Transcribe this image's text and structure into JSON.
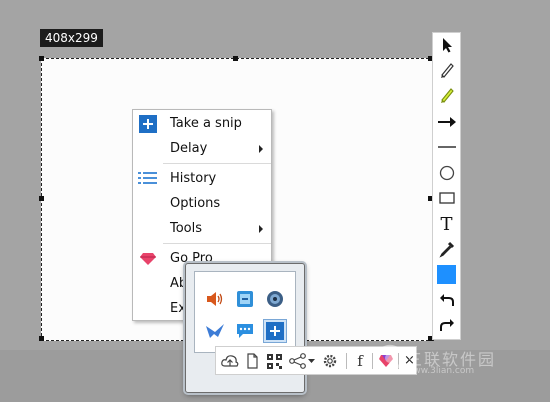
{
  "selection": {
    "size_label": "408x299"
  },
  "context_menu": {
    "items": [
      {
        "label": "Take a snip",
        "icon": "plus-icon"
      },
      {
        "label": "Delay",
        "icon": "",
        "submenu": true
      },
      {
        "label": "History",
        "icon": "list-icon"
      },
      {
        "label": "Options",
        "icon": ""
      },
      {
        "label": "Tools",
        "icon": "",
        "submenu": true
      },
      {
        "label": "Go Pro",
        "icon": "gem-icon"
      },
      {
        "label": "Ab",
        "icon": ""
      },
      {
        "label": "Ex",
        "icon": ""
      }
    ]
  },
  "right_toolbar": {
    "tools": [
      "pointer-icon",
      "pen-icon",
      "highlighter-icon",
      "arrow-icon",
      "line-icon",
      "circle-icon",
      "rectangle-icon",
      "text-icon",
      "eyedropper-icon",
      "color-swatch",
      "undo-icon",
      "redo-icon"
    ],
    "color": "#1e90ff",
    "text_tool_label": "T"
  },
  "popup": {
    "icons": [
      "speaker-icon",
      "qq-icon",
      "disc-icon",
      "bird-icon",
      "chat-icon",
      "plus-icon"
    ]
  },
  "bottom_toolbar": {
    "items": [
      "cloud-upload-icon",
      "copy-icon",
      "qr-code-icon",
      "share-icon",
      "gear-icon",
      "facebook-icon",
      "gem-icon"
    ],
    "facebook_label": "f",
    "close_label": "×"
  },
  "watermark": {
    "text": "三联软件园",
    "sub": "www.3lian.com"
  }
}
